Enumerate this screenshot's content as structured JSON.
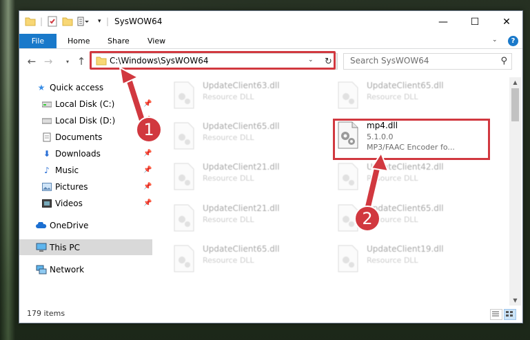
{
  "window": {
    "title": "SysWOW64",
    "controls": {
      "minimize": "—",
      "maximize": "☐",
      "close": "✕"
    }
  },
  "ribbon": {
    "tabs": [
      {
        "label": "File"
      },
      {
        "label": "Home"
      },
      {
        "label": "Share"
      },
      {
        "label": "View"
      }
    ],
    "help": "?"
  },
  "address": {
    "path": "C:\\Windows\\SysWOW64",
    "search_placeholder": "Search SysWOW64"
  },
  "sidebar": {
    "items": [
      {
        "label": "Quick access",
        "icon": "star-icon",
        "pinned": false
      },
      {
        "label": "Local Disk (C:)",
        "icon": "drive-icon",
        "pinned": true
      },
      {
        "label": "Local Disk (D:)",
        "icon": "drive-icon",
        "pinned": true
      },
      {
        "label": "Documents",
        "icon": "documents-icon",
        "pinned": true
      },
      {
        "label": "Downloads",
        "icon": "download-icon",
        "pinned": true
      },
      {
        "label": "Music",
        "icon": "music-icon",
        "pinned": true
      },
      {
        "label": "Pictures",
        "icon": "pictures-icon",
        "pinned": true
      },
      {
        "label": "Videos",
        "icon": "videos-icon",
        "pinned": true
      },
      {
        "label": "OneDrive",
        "icon": "cloud-icon",
        "pinned": false
      },
      {
        "label": "This PC",
        "icon": "computer-icon",
        "pinned": false,
        "selected": true
      },
      {
        "label": "Network",
        "icon": "network-icon",
        "pinned": false
      }
    ]
  },
  "files": {
    "left_column": [
      {
        "name": "UpdateClient63.dll",
        "sub": "Resource DLL"
      },
      {
        "name": "UpdateClient65.dll",
        "sub": "Resource DLL"
      },
      {
        "name": "UpdateClient21.dll",
        "sub": "Resource DLL"
      },
      {
        "name": "UpdateClient21.dll",
        "sub": "Resource DLL"
      },
      {
        "name": "UpdateClient65.dll",
        "sub": "Resource DLL"
      }
    ],
    "right_column": [
      {
        "name": "UpdateClient65.dll",
        "sub": "Resource DLL"
      },
      {
        "name": "UpdateClient42.dll",
        "sub": "Resource DLL"
      },
      {
        "name": "UpdateClient65.dll",
        "sub": "Resource DLL"
      },
      {
        "name": "UpdateClient19.dll",
        "sub": "Resource DLL"
      }
    ],
    "highlighted": {
      "name": "mp4.dll",
      "version": "5.1.0.0",
      "description": "MP3/FAAC Encoder fo..."
    }
  },
  "status": {
    "item_count": "179 items"
  },
  "callouts": {
    "one": "1",
    "two": "2"
  },
  "colors": {
    "accent": "#1979ca",
    "highlight_red": "#d1383f"
  }
}
